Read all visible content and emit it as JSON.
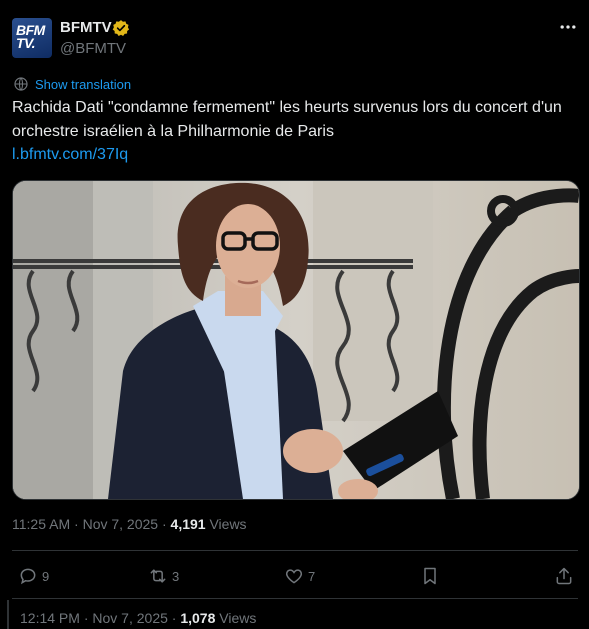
{
  "account": {
    "name": "BFMTV",
    "handle": "@BFMTV",
    "avatar_text_line1": "BFM",
    "avatar_text_line2": "TV."
  },
  "translate_label": "Show translation",
  "tweet": {
    "text": "Rachida Dati \"condamne fermement\" les heurts survenus lors du concert d'un orchestre israélien à la Philharmonie de Paris",
    "link": "l.bfmtv.com/37Iq",
    "time": "11:25 AM",
    "date": "Nov 7, 2025",
    "views_count": "4,191",
    "views_label": "Views"
  },
  "actions": {
    "replies": "9",
    "reposts": "3",
    "likes": "7"
  },
  "reply": {
    "time": "12:14 PM",
    "date": "Nov 7, 2025",
    "views_count": "1,078",
    "views_label": "Views"
  },
  "colors": {
    "accent": "#1d9bf0",
    "background": "#000000",
    "text": "#e7e9ea",
    "muted": "#71767b",
    "verified_gold": "#e2b719"
  },
  "icons": [
    "more-icon",
    "verified-badge-icon",
    "translate-icon",
    "reply-icon",
    "repost-icon",
    "like-icon",
    "bookmark-icon",
    "share-icon"
  ]
}
